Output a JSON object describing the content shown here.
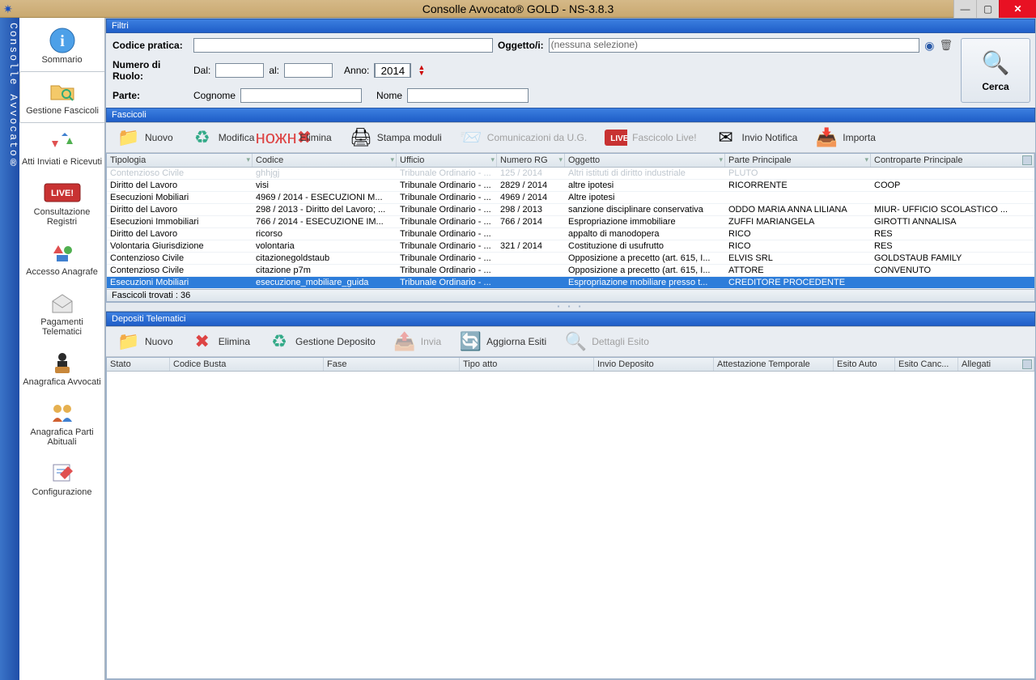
{
  "title": "Consolle Avvocato® GOLD - NS-3.8.3",
  "brand": "Consolle Avvocato®",
  "nav": {
    "sommario": "Sommario",
    "gestione": "Gestione Fascicoli",
    "atti": "Atti Inviati e Ricevuti",
    "consultazione": "Consultazione Registri",
    "anagrafe": "Accesso Anagrafe",
    "pagamenti": "Pagamenti Telematici",
    "avvocati": "Anagrafica Avvocati",
    "parti": "Anagrafica Parti Abituali",
    "config": "Configurazione"
  },
  "panels": {
    "filtri": "Filtri",
    "fascicoli": "Fascicoli",
    "depositi": "Depositi Telematici"
  },
  "filters": {
    "codice_pratica_lbl": "Codice pratica:",
    "oggetto_lbl": "Oggetto/i:",
    "oggetto_val": "(nessuna selezione)",
    "ruolo_lbl": "Numero di Ruolo:",
    "dal": "Dal:",
    "al": "al:",
    "anno": "Anno:",
    "anno_val": "2014",
    "parte_lbl": "Parte:",
    "cognome": "Cognome",
    "nome": "Nome",
    "cerca": "Cerca"
  },
  "toolbar_f": {
    "nuovo": "Nuovo",
    "modifica": "Modifica",
    "elimina": "Elimina",
    "stampa": "Stampa moduli",
    "comunicazioni": "Comunicazioni da U.G.",
    "live": "Fascicolo Live!",
    "invio": "Invio Notifica",
    "importa": "Importa"
  },
  "cols_f": [
    "Tipologia",
    "Codice",
    "Ufficio",
    "Numero RG",
    "Oggetto",
    "Parte Principale",
    "Controparte Principale"
  ],
  "rows_f": [
    {
      "dim": true,
      "c": [
        "Contenzioso Civile",
        "ghhjgj",
        "Tribunale Ordinario - ...",
        "125 / 2014",
        "Altri istituti di diritto industriale",
        "PLUTO",
        ""
      ]
    },
    {
      "c": [
        "Diritto del Lavoro",
        "visi",
        "Tribunale Ordinario - ...",
        "2829 / 2014",
        "altre ipotesi",
        "RICORRENTE",
        "COOP"
      ]
    },
    {
      "c": [
        "Esecuzioni Mobiliari",
        "4969 / 2014 - ESECUZIONI M...",
        "Tribunale Ordinario - ...",
        "4969 / 2014",
        "Altre ipotesi",
        "",
        ""
      ]
    },
    {
      "c": [
        "Diritto del Lavoro",
        "298 / 2013 - Diritto del Lavoro; ...",
        "Tribunale Ordinario - ...",
        "298 / 2013",
        "sanzione disciplinare conservativa",
        "ODDO MARIA ANNA LILIANA",
        "MIUR- UFFICIO SCOLASTICO ..."
      ]
    },
    {
      "c": [
        "Esecuzioni Immobiliari",
        "766 / 2014 - ESECUZIONE IM...",
        "Tribunale Ordinario - ...",
        "766 / 2014",
        "Espropriazione immobiliare",
        "ZUFFI MARIANGELA",
        "GIROTTI ANNALISA"
      ]
    },
    {
      "c": [
        "Diritto del Lavoro",
        "ricorso",
        "Tribunale Ordinario - ...",
        "",
        "appalto di manodopera",
        "RICO",
        "RES"
      ]
    },
    {
      "c": [
        "Volontaria Giurisdizione",
        "volontaria",
        "Tribunale Ordinario - ...",
        "321 / 2014",
        "Costituzione di usufrutto",
        "RICO",
        "RES"
      ]
    },
    {
      "c": [
        "Contenzioso Civile",
        "citazionegoldstaub",
        "Tribunale Ordinario - ...",
        "",
        "Opposizione a precetto (art. 615, I...",
        "ELVIS SRL",
        "GOLDSTAUB FAMILY"
      ]
    },
    {
      "c": [
        "Contenzioso Civile",
        "citazione p7m",
        "Tribunale Ordinario - ...",
        "",
        "Opposizione a precetto (art. 615, I...",
        "ATTORE",
        "CONVENUTO"
      ]
    },
    {
      "sel": true,
      "c": [
        "Esecuzioni Mobiliari",
        "esecuzione_mobiliare_guida",
        "Tribunale Ordinario - ...",
        "",
        "Espropriazione mobiliare presso t...",
        "CREDITORE PROCEDENTE",
        ""
      ]
    }
  ],
  "status_f": "Fascicoli trovati :  36",
  "toolbar_d": {
    "nuovo": "Nuovo",
    "elimina": "Elimina",
    "gestione": "Gestione Deposito",
    "invia": "Invia",
    "aggiorna": "Aggiorna Esiti",
    "dettagli": "Dettagli Esito"
  },
  "cols_d": [
    "Stato",
    "Codice Busta",
    "Fase",
    "Tipo atto",
    "Invio Deposito",
    "Attestazione Temporale",
    "Esito Auto",
    "Esito Canc...",
    "Allegati"
  ]
}
